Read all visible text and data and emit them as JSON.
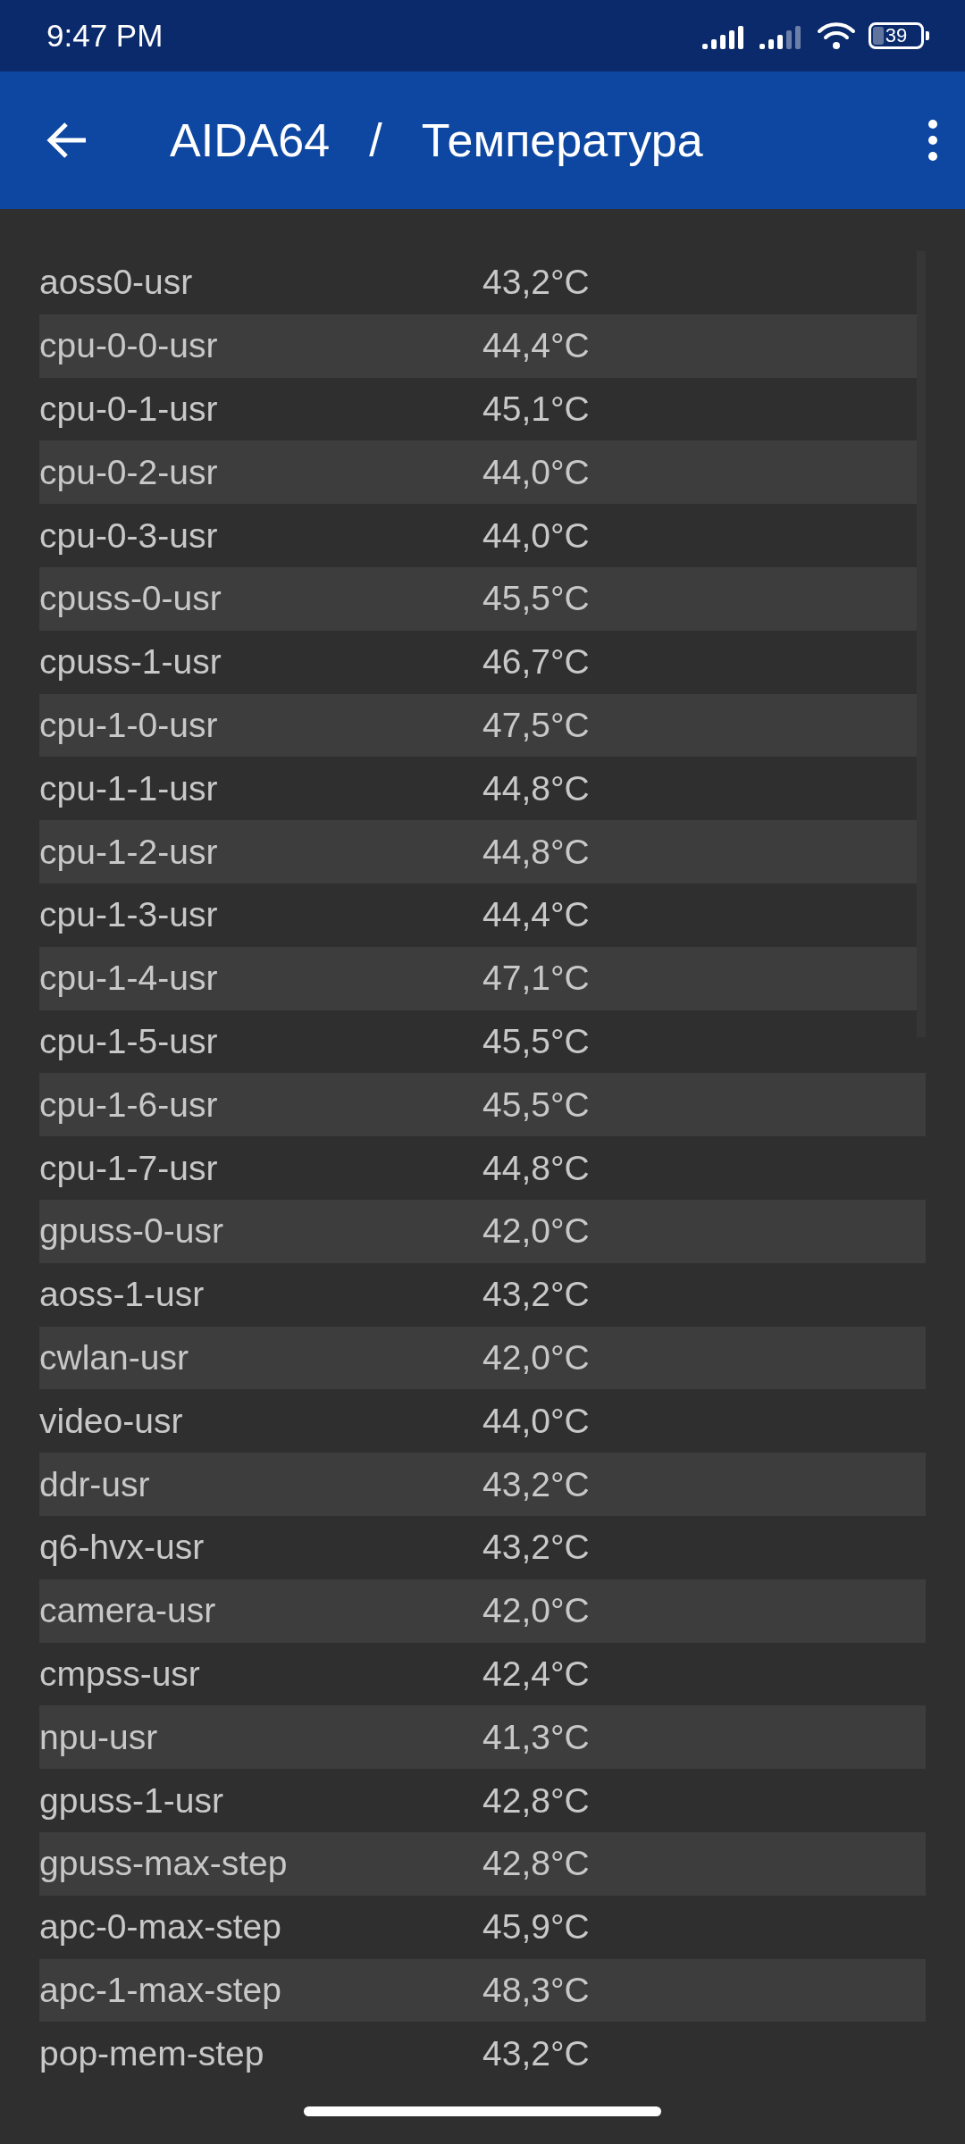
{
  "status_bar": {
    "time": "9:47 PM",
    "battery": "39"
  },
  "app_bar": {
    "title": "AIDA64",
    "separator": "/",
    "subtitle": "Температура"
  },
  "sensors": [
    {
      "name": "aoss0-usr",
      "value": "43,2°C"
    },
    {
      "name": "cpu-0-0-usr",
      "value": "44,4°C"
    },
    {
      "name": "cpu-0-1-usr",
      "value": "45,1°C"
    },
    {
      "name": "cpu-0-2-usr",
      "value": "44,0°C"
    },
    {
      "name": "cpu-0-3-usr",
      "value": "44,0°C"
    },
    {
      "name": "cpuss-0-usr",
      "value": "45,5°C"
    },
    {
      "name": "cpuss-1-usr",
      "value": "46,7°C"
    },
    {
      "name": "cpu-1-0-usr",
      "value": "47,5°C"
    },
    {
      "name": "cpu-1-1-usr",
      "value": "44,8°C"
    },
    {
      "name": "cpu-1-2-usr",
      "value": "44,8°C"
    },
    {
      "name": "cpu-1-3-usr",
      "value": "44,4°C"
    },
    {
      "name": "cpu-1-4-usr",
      "value": "47,1°C"
    },
    {
      "name": "cpu-1-5-usr",
      "value": "45,5°C"
    },
    {
      "name": "cpu-1-6-usr",
      "value": "45,5°C"
    },
    {
      "name": "cpu-1-7-usr",
      "value": "44,8°C"
    },
    {
      "name": "gpuss-0-usr",
      "value": "42,0°C"
    },
    {
      "name": "aoss-1-usr",
      "value": "43,2°C"
    },
    {
      "name": "cwlan-usr",
      "value": "42,0°C"
    },
    {
      "name": "video-usr",
      "value": "44,0°C"
    },
    {
      "name": "ddr-usr",
      "value": "43,2°C"
    },
    {
      "name": "q6-hvx-usr",
      "value": "43,2°C"
    },
    {
      "name": "camera-usr",
      "value": "42,0°C"
    },
    {
      "name": "cmpss-usr",
      "value": "42,4°C"
    },
    {
      "name": "npu-usr",
      "value": "41,3°C"
    },
    {
      "name": "gpuss-1-usr",
      "value": "42,8°C"
    },
    {
      "name": "gpuss-max-step",
      "value": "42,8°C"
    },
    {
      "name": "apc-0-max-step",
      "value": "45,9°C"
    },
    {
      "name": "apc-1-max-step",
      "value": "48,3°C"
    },
    {
      "name": "pop-mem-step",
      "value": "43,2°C"
    }
  ]
}
